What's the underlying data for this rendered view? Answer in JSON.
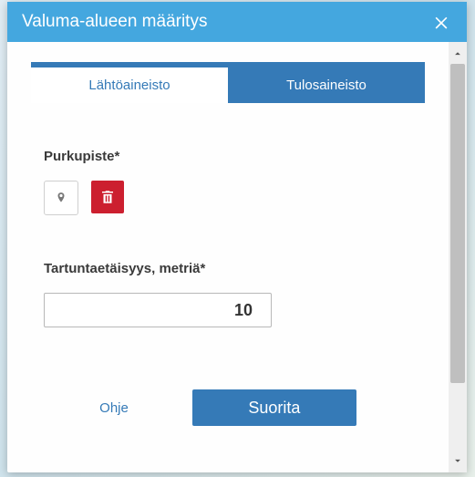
{
  "dialog": {
    "title": "Valuma-alueen määritys"
  },
  "tabs": {
    "source": "Lähtöaineisto",
    "result": "Tulosaineisto"
  },
  "fields": {
    "purkupiste_label": "Purkupiste*",
    "distance_label": "Tartuntaetäisyys, metriä*",
    "distance_value": "10"
  },
  "footer": {
    "help": "Ohje",
    "run": "Suorita"
  },
  "icons": {
    "close": "close-icon",
    "marker": "marker-icon",
    "trash": "trash-icon",
    "chevron_up": "chevron-up-icon",
    "chevron_down": "chevron-down-icon"
  }
}
